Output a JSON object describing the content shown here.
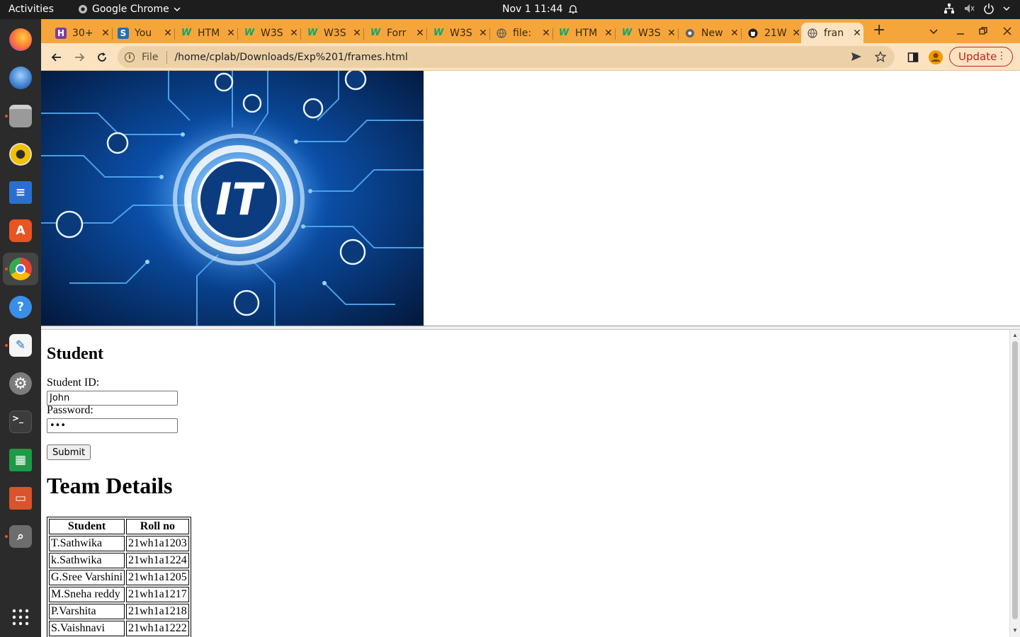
{
  "topbar": {
    "activities": "Activities",
    "app_name": "Google Chrome",
    "clock": "Nov 1  11:44"
  },
  "dock": {
    "items": [
      {
        "name": "firefox",
        "color": "#ff7139"
      },
      {
        "name": "thunderbird",
        "color": "#2f72c4"
      },
      {
        "name": "files",
        "color": "#8d8d8d"
      },
      {
        "name": "rhythmbox",
        "color": "#f2c100"
      },
      {
        "name": "libreoffice-writer",
        "color": "#2a6fd0"
      },
      {
        "name": "app-center",
        "color": "#e95420"
      },
      {
        "name": "chrome",
        "color": "#34a853"
      },
      {
        "name": "help",
        "color": "#3a8ee6"
      },
      {
        "name": "text-editor",
        "color": "#f5f5f5"
      },
      {
        "name": "settings",
        "color": "#7c7c7c"
      },
      {
        "name": "terminal",
        "color": "#3c3c3c"
      },
      {
        "name": "libreoffice-calc",
        "color": "#1e9a46"
      },
      {
        "name": "libreoffice-impress",
        "color": "#d9532c"
      },
      {
        "name": "image-viewer",
        "color": "#6d6d6d"
      },
      {
        "name": "show-apps",
        "color": "#2b2b2b"
      }
    ]
  },
  "tabs": [
    {
      "title": "30+",
      "icon": "H",
      "icon_bg": "#7b3fa0"
    },
    {
      "title": "You",
      "icon": "S",
      "icon_bg": "#1b6ec2"
    },
    {
      "title": "HTM",
      "icon": "W",
      "icon_bg": "#04aa6d"
    },
    {
      "title": "W3S",
      "icon": "W",
      "icon_bg": "#04aa6d"
    },
    {
      "title": "W3S",
      "icon": "W",
      "icon_bg": "#04aa6d"
    },
    {
      "title": "Forr",
      "icon": "W",
      "icon_bg": "#04aa6d"
    },
    {
      "title": "W3S",
      "icon": "W",
      "icon_bg": "#04aa6d"
    },
    {
      "title": "file:",
      "icon": "globe",
      "icon_bg": "#6b6b6b"
    },
    {
      "title": "HTM",
      "icon": "W",
      "icon_bg": "#04aa6d"
    },
    {
      "title": "W3S",
      "icon": "W",
      "icon_bg": "#04aa6d"
    },
    {
      "title": "New",
      "icon": "chrome",
      "icon_bg": "#4a4a4a"
    },
    {
      "title": "21W",
      "icon": "github",
      "icon_bg": "#1f1f1f"
    },
    {
      "title": "fran",
      "icon": "globe",
      "icon_bg": "#6b6b6b"
    }
  ],
  "toolbar": {
    "scheme": "File",
    "url": "/home/cplab/Downloads/Exp%201/frames.html",
    "update_label": "Update"
  },
  "hero": {
    "logo_text": "IT"
  },
  "form": {
    "heading": "Student",
    "id_label": "Student ID:",
    "id_value": "John",
    "password_label": "Password:",
    "password_value": "•••",
    "submit_label": "Submit"
  },
  "team": {
    "heading": "Team Details",
    "columns": [
      "Student",
      "Roll no"
    ],
    "rows": [
      [
        "T.Sathwika",
        "21wh1a1203"
      ],
      [
        "k.Sathwika",
        "21wh1a1224"
      ],
      [
        "G.Sree Varshini",
        "21wh1a1205"
      ],
      [
        "M.Sneha reddy",
        "21wh1a1217"
      ],
      [
        "P.Varshita",
        "21wh1a1218"
      ],
      [
        "S.Vaishnavi",
        "21wh1a1222"
      ]
    ]
  }
}
